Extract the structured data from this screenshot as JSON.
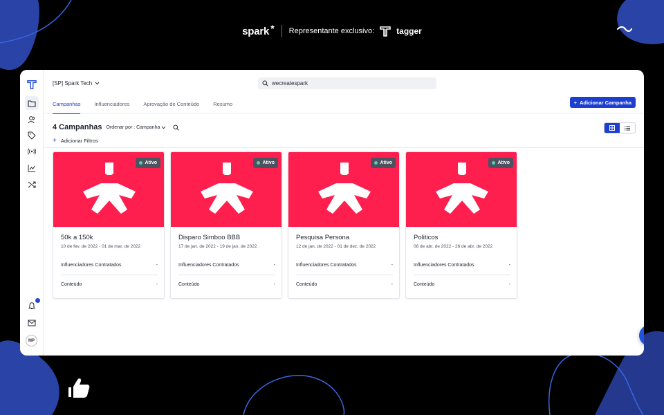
{
  "brand": {
    "spark": "spark",
    "spark_star": "*",
    "representative": "Representante exclusivo:",
    "tagger": "tagger"
  },
  "header": {
    "org_selector": "[SP] Spark Tech",
    "search_value": "wecreatespark",
    "add_campaign_label": "Adicionar Campanha"
  },
  "tabs": [
    {
      "label": "Campanhas",
      "active": true
    },
    {
      "label": "Influenciadores",
      "active": false
    },
    {
      "label": "Aprovação de Conteúdo",
      "active": false
    },
    {
      "label": "Resumo",
      "active": false
    }
  ],
  "list": {
    "count_title": "4 Campanhas",
    "sort_label": "Ordenar por : Campanha",
    "add_filters": "Adicionar Filtros"
  },
  "sidebar": {
    "avatar_initials": "MP",
    "icons": [
      "tagger-logo-icon",
      "folder-icon",
      "users-icon",
      "tag-icon",
      "broadcast-icon",
      "chart-icon",
      "shuffle-icon",
      "bell-icon",
      "mail-icon"
    ]
  },
  "cards": [
    {
      "title": "50k a 150k",
      "dates": "10 de fev. de 2022 - 01 de mar. de 2022",
      "status": "Ativo",
      "rows": [
        {
          "label": "Influenciadores Contratados",
          "value": "-"
        },
        {
          "label": "Conteúdo",
          "value": "-"
        }
      ]
    },
    {
      "title": "Disparo Simboo BBB",
      "dates": "17 de jan. de 2022 - 19 de jan. de 2022",
      "status": "Ativo",
      "rows": [
        {
          "label": "Influenciadores Contratados",
          "value": "-"
        },
        {
          "label": "Conteúdo",
          "value": "-"
        }
      ]
    },
    {
      "title": "Pesquisa Persona",
      "dates": "12 de jan. de 2022 - 01 de dez. de 2022",
      "status": "Ativo",
      "rows": [
        {
          "label": "Influenciadores Contratados",
          "value": "-"
        },
        {
          "label": "Conteúdo",
          "value": "-"
        }
      ]
    },
    {
      "title": "Politicos",
      "dates": "08 de abr. de 2022 - 26 de abr. de 2022",
      "status": "Ativo",
      "rows": [
        {
          "label": "Influenciadores Contratados",
          "value": "-"
        },
        {
          "label": "Conteúdo",
          "value": "-"
        }
      ]
    }
  ],
  "colors": {
    "accent": "#1d3fcf",
    "banner": "#fe1f4f",
    "badge": "#4c525f",
    "decor_blue": "#2a43a6"
  }
}
